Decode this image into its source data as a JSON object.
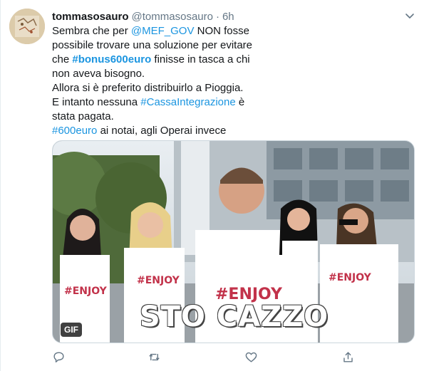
{
  "tweet": {
    "display_name": "tommasosauro",
    "handle": "@tommasosauro",
    "separator": "·",
    "time": "6h",
    "lines": [
      [
        {
          "t": "Sembra che per "
        },
        {
          "t": "@MEF_GOV",
          "cls": "link"
        },
        {
          "t": " NON fosse"
        }
      ],
      [
        {
          "t": "possibile trovare una soluzione per evitare"
        }
      ],
      [
        {
          "t": "che "
        },
        {
          "t": "#bonus600euro",
          "cls": "link bold"
        },
        {
          "t": " finisse in tasca a chi"
        }
      ],
      [
        {
          "t": "non aveva bisogno."
        }
      ],
      [
        {
          "t": "Allora si è preferito distribuirlo a Pioggia."
        }
      ],
      [
        {
          "t": "E intanto nessuna "
        },
        {
          "t": "#CassaIntegrazione",
          "cls": "link"
        },
        {
          "t": " è"
        }
      ],
      [
        {
          "t": "stata pagata."
        }
      ],
      [
        {
          "t": "#600euro",
          "cls": "link"
        },
        {
          "t": " ai notai, agli Operai invece"
        }
      ]
    ],
    "media": {
      "caption": "STO CAZZO",
      "badge": "GIF",
      "shirt_text": "#ENJOY"
    }
  },
  "icons": {
    "caret": "chevron-down-icon",
    "reply": "reply-icon",
    "retweet": "retweet-icon",
    "like": "heart-icon",
    "share": "share-icon"
  },
  "colors": {
    "link": "#1b95e0",
    "secondary": "#657786",
    "text": "#14171a"
  }
}
